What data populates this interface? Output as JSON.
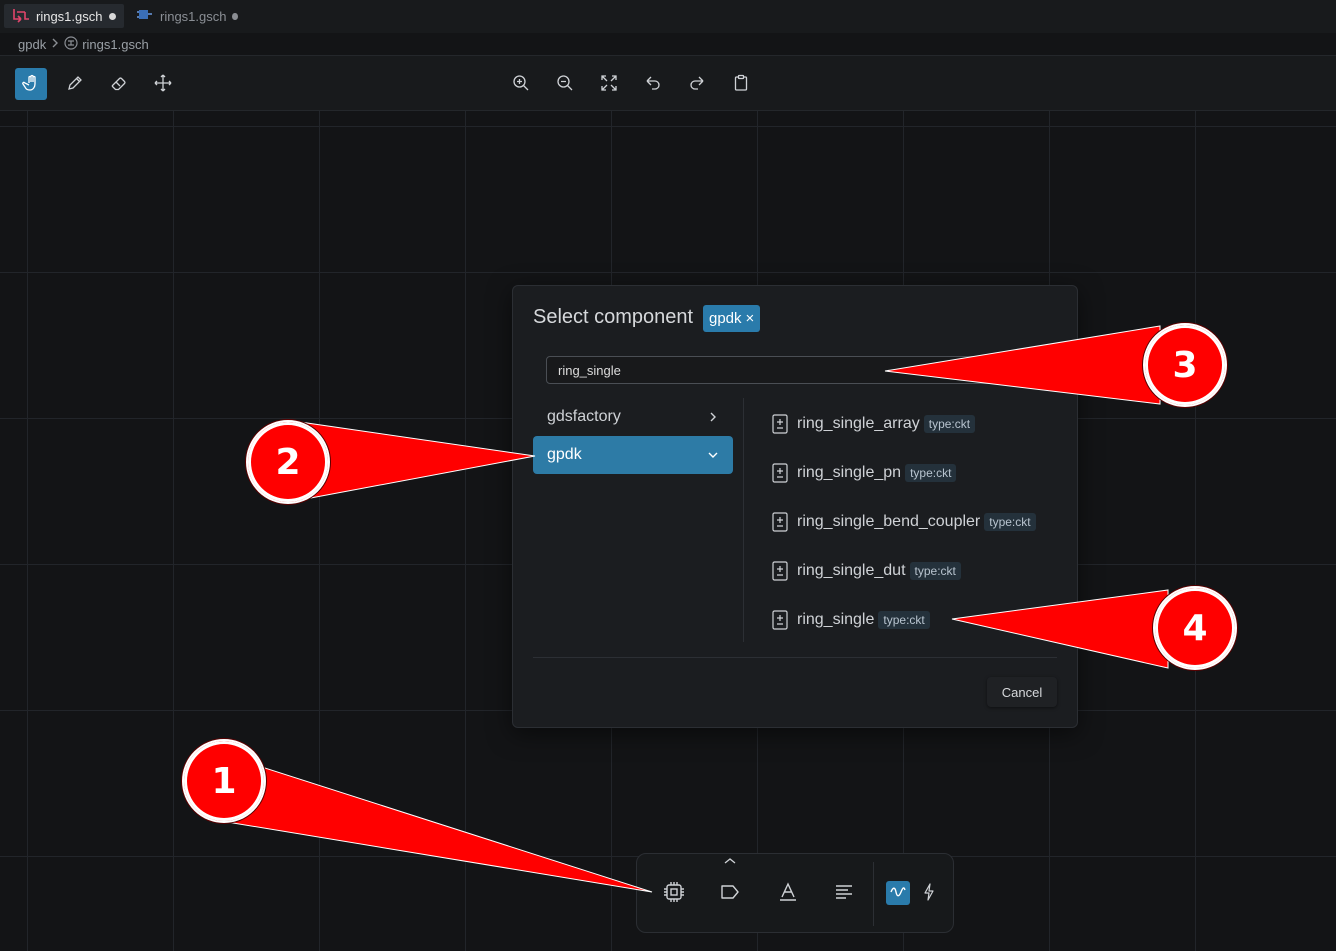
{
  "tabs": [
    {
      "label": "rings1.gsch",
      "active": true
    },
    {
      "label": "rings1.gsch",
      "active": false
    }
  ],
  "breadcrumb": {
    "library": "gpdk",
    "file": "rings1.gsch"
  },
  "toolbar": {
    "tools": [
      "hand-icon",
      "pencil-icon",
      "eraser-icon",
      "move-icon"
    ],
    "actions": [
      "zoom-in-icon",
      "zoom-out-icon",
      "fit-icon",
      "undo-icon",
      "redo-icon",
      "clipboard-icon"
    ]
  },
  "dialog": {
    "title": "Select component",
    "filter_chip": "gpdk",
    "chip_close": "×",
    "search_value": "ring_single",
    "libraries": [
      {
        "name": "gdsfactory",
        "expanded": false
      },
      {
        "name": "gpdk",
        "expanded": true
      }
    ],
    "components": [
      {
        "name": "ring_single_array",
        "type": "type:ckt"
      },
      {
        "name": "ring_single_pn",
        "type": "type:ckt"
      },
      {
        "name": "ring_single_bend_coupler",
        "type": "type:ckt"
      },
      {
        "name": "ring_single_dut",
        "type": "type:ckt"
      },
      {
        "name": "ring_single",
        "type": "type:ckt"
      }
    ],
    "cancel_label": "Cancel"
  },
  "palette": {
    "tools": [
      "chip-icon",
      "label-icon",
      "text-icon",
      "align-icon",
      "wave-icon",
      "lightning-icon"
    ],
    "collapse_icon": "chevron-up-icon"
  },
  "callouts": [
    "1",
    "2",
    "3",
    "4"
  ],
  "colors": {
    "accent": "#2a7bab",
    "callout": "#ff0000"
  }
}
